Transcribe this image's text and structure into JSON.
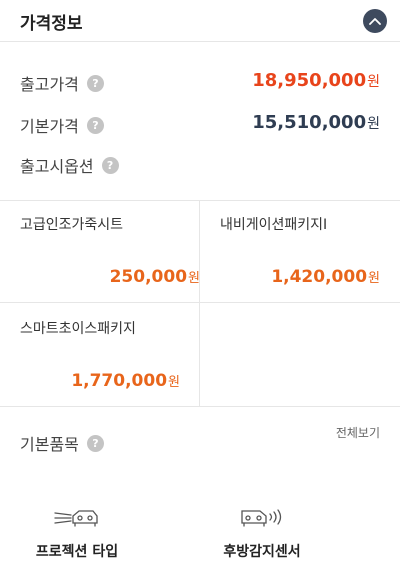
{
  "header": {
    "title": "가격정보",
    "collapse_icon": "chevron-up-icon"
  },
  "prices": [
    {
      "label": "출고가격",
      "value": "18,950,000",
      "unit": "원",
      "color": "#e8441b"
    },
    {
      "label": "기본가격",
      "value": "15,510,000",
      "unit": "원",
      "color": "#2f3d52"
    },
    {
      "label": "출고시옵션"
    }
  ],
  "help_icon_text": "?",
  "options": [
    {
      "name": "고급인조가죽시트",
      "price": "250,000",
      "unit": "원"
    },
    {
      "name": "내비게이션패키지I",
      "price": "1,420,000",
      "unit": "원"
    },
    {
      "name": "스마트초이스패키지",
      "price": "1,770,000",
      "unit": "원"
    }
  ],
  "basic_items": {
    "title": "기본품목",
    "view_all": "전체보기",
    "items": [
      {
        "label": "프로젝션 타입",
        "icon": "projection-headlamp-icon"
      },
      {
        "label": "후방감지센서",
        "icon": "rear-sensor-icon"
      }
    ]
  },
  "colors": {
    "accent_red": "#e8441b",
    "accent_orange": "#e8651b",
    "navy": "#3e4a5e"
  }
}
